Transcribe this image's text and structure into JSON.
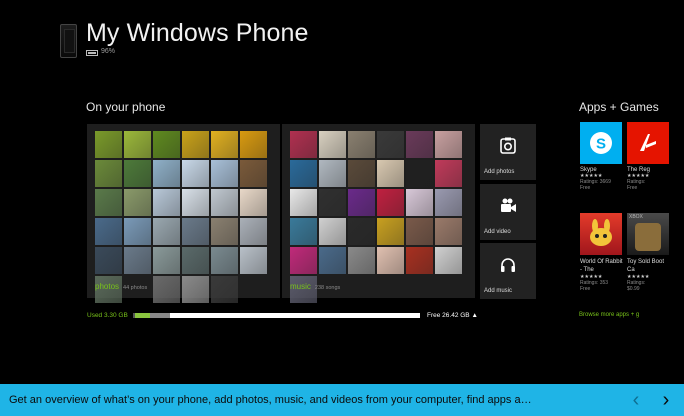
{
  "header": {
    "title": "My Windows Phone",
    "battery": "96%"
  },
  "section": {
    "title": "On your phone"
  },
  "tiles": {
    "photos": {
      "label": "photos",
      "count": "44 photos"
    },
    "music": {
      "label": "music",
      "count": "238 songs"
    }
  },
  "actions": [
    {
      "label": "Add photos",
      "icon": "camera-icon"
    },
    {
      "label": "Add video",
      "icon": "video-camera-icon"
    },
    {
      "label": "Add music",
      "icon": "headphones-icon"
    }
  ],
  "storage": {
    "used": "Used 3.30 GB",
    "free": "Free 26.42 GB ▲",
    "colors": {
      "used_green": "#8bc53f",
      "used_gray": "#888888",
      "free": "#ffffff"
    }
  },
  "apps": {
    "title": "Apps + Games",
    "items": [
      {
        "name": "Skype",
        "stars": "★★★★★",
        "ratings": "Ratings: 3669",
        "price": "Free",
        "color": "#00aff0"
      },
      {
        "name": "The Reg",
        "stars": "★★★★★",
        "ratings": "Ratings:",
        "price": "Free",
        "color": "#e51400"
      },
      {
        "name": "World Of Rabbit - The",
        "stars": "★★★★★",
        "ratings": "Ratings: 353",
        "price": "Free",
        "color": "#d0202a"
      },
      {
        "name": "Toy Sold Boot Ca",
        "stars": "★★★★★",
        "ratings": "Ratings:",
        "price": "$0.99",
        "color": "#3a3a3a"
      }
    ],
    "browse": "Browse more apps + g"
  },
  "footer": {
    "text": "Get an overview of what’s on your phone, add photos, music, and videos from your computer, find apps a…",
    "prev": "‹",
    "next": "›"
  },
  "colors": {
    "accent_green": "#78c21a",
    "bar_blue": "#1fb4e6",
    "tile_bg": "#1e1e1e"
  }
}
